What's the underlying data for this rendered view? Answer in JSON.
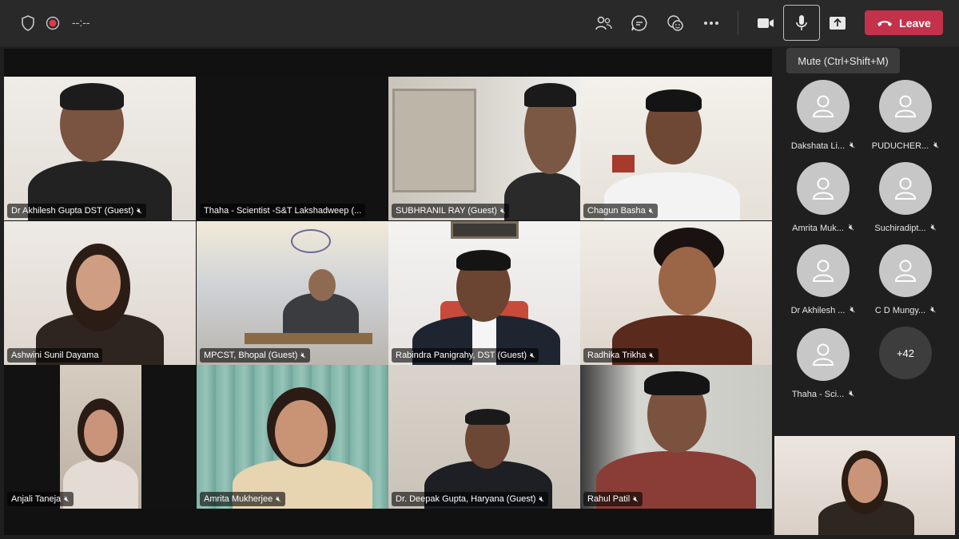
{
  "toolbar": {
    "timer": "--:--",
    "leave_label": "Leave",
    "icons": [
      "shield-icon",
      "record-icon",
      "people-icon",
      "chat-icon",
      "reactions-icon",
      "more-icon",
      "camera-icon",
      "microphone-icon",
      "share-icon",
      "phone-hangup-icon"
    ],
    "leave_color": "#c4314b"
  },
  "tooltip": {
    "text": "Mute (Ctrl+Shift+M)"
  },
  "tiles": [
    {
      "name": "Dr Akhilesh Gupta DST (Guest)"
    },
    {
      "name": "Thaha - Scientist -S&T Lakshadweep (..."
    },
    {
      "name": "SUBHRANIL RAY (Guest)"
    },
    {
      "name": "Chagun Basha"
    },
    {
      "name": "Ashwini Sunil Dayama"
    },
    {
      "name": "MPCST, Bhopal (Guest)"
    },
    {
      "name": "Rabindra Panigrahy, DST (Guest)"
    },
    {
      "name": "Radhika Trikha"
    },
    {
      "name": "Anjali Taneja"
    },
    {
      "name": "Amrita Mukherjee"
    },
    {
      "name": "Dr. Deepak Gupta, Haryana (Guest)"
    },
    {
      "name": "Rahul  Patil"
    }
  ],
  "roster": [
    {
      "name": "Dakshata Li..."
    },
    {
      "name": "PUDUCHER..."
    },
    {
      "name": "Amrita Muk..."
    },
    {
      "name": "Suchiradipt..."
    },
    {
      "name": "Dr Akhilesh ..."
    },
    {
      "name": "C D Mungy..."
    },
    {
      "name": "Thaha - Sci..."
    }
  ],
  "overflow_count": "+42"
}
